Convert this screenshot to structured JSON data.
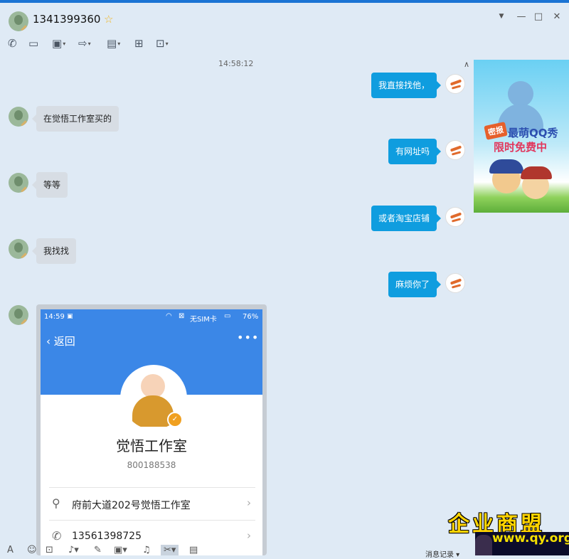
{
  "window": {
    "contact_name": "1341399360"
  },
  "toolbar": {
    "icons": [
      "phone-icon",
      "video-icon",
      "screen-share-icon",
      "file-transfer-icon",
      "remote-desktop-icon",
      "add-icon",
      "apps-icon"
    ]
  },
  "chat": {
    "timestamp": "14:58:12",
    "messages": [
      {
        "side": "out",
        "text": "我直接找他，"
      },
      {
        "side": "in",
        "text": "在觉悟工作室买的"
      },
      {
        "side": "out",
        "text": "有网址吗"
      },
      {
        "side": "in",
        "text": "等等"
      },
      {
        "side": "out",
        "text": "或者淘宝店铺"
      },
      {
        "side": "in",
        "text": "我找找"
      },
      {
        "side": "out",
        "text": "麻烦你了"
      }
    ]
  },
  "ad": {
    "tag": "密报",
    "line1": "最萌QQ秀",
    "line2": "限时免费中"
  },
  "phone": {
    "time": "14:59",
    "sim": "无SIM卡",
    "battery": "76%",
    "back": "返回",
    "name": "觉悟工作室",
    "id": "800188538",
    "address": "府前大道202号觉悟工作室",
    "phone": "13561398725"
  },
  "bottom": {
    "history": "消息记录"
  },
  "watermark": {
    "title": "企业商盟",
    "url": "www.qy.org.cn"
  }
}
